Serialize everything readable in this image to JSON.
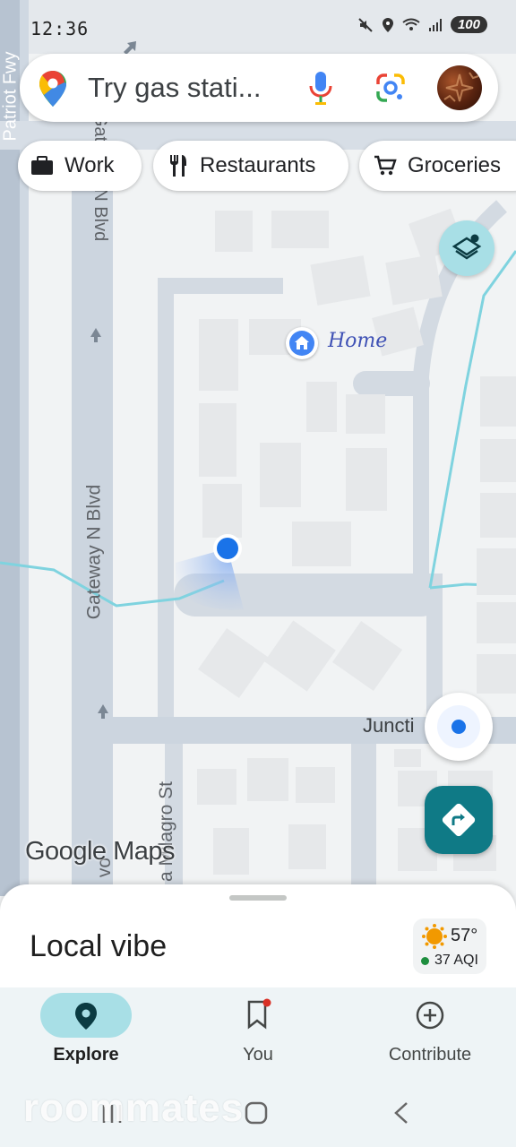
{
  "status_bar": {
    "time": "12:36",
    "battery": "100"
  },
  "search": {
    "placeholder": "Try gas stati..."
  },
  "chips": [
    {
      "label": "Work",
      "icon": "briefcase-icon"
    },
    {
      "label": "Restaurants",
      "icon": "fork-knife-icon"
    },
    {
      "label": "Groceries",
      "icon": "cart-icon"
    }
  ],
  "map": {
    "roads": {
      "patriot": "Patriot Fwy",
      "gateway_top": "Gateway N Blvd",
      "gateway": "Gateway N Blvd",
      "junction": "Juncti",
      "milagro": "a Milagro St",
      "vo": "vo"
    },
    "home_label": "Home",
    "attribution": "Google Maps"
  },
  "sheet": {
    "title": "Local vibe",
    "weather": {
      "temp": "57°",
      "aqi": "37 AQI"
    }
  },
  "nav": {
    "explore": "Explore",
    "you": "You",
    "contribute": "Contribute"
  },
  "watermark": "roommates",
  "colors": {
    "accent": "#0f7a86",
    "pill": "#a8dfe6",
    "location_blue": "#1a73e8",
    "river": "#7fd3df"
  }
}
